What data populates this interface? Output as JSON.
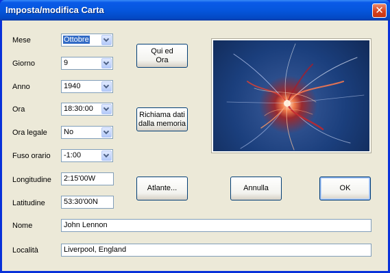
{
  "window": {
    "title": "Imposta/modifica Carta",
    "close_glyph": "✕"
  },
  "fields": {
    "mese": {
      "label": "Mese",
      "value": "Ottobre"
    },
    "giorno": {
      "label": "Giorno",
      "value": "9"
    },
    "anno": {
      "label": "Anno",
      "value": "1940"
    },
    "ora": {
      "label": "Ora",
      "value": "18:30:00"
    },
    "ora_legale": {
      "label": "Ora legale",
      "value": "No"
    },
    "fuso": {
      "label": "Fuso orario",
      "value": "-1:00"
    },
    "longitudine": {
      "label": "Longitudine",
      "value": "2:15'00W"
    },
    "latitudine": {
      "label": "Latitudine",
      "value": "53:30'00N"
    },
    "nome": {
      "label": "Nome",
      "value": "John Lennon"
    },
    "localita": {
      "label": "Località",
      "value": "Liverpool, England"
    }
  },
  "buttons": {
    "qui_ed_ora": [
      "Qui ed",
      "Ora"
    ],
    "richiama": [
      "Richiama dati",
      "dalla memoria"
    ],
    "atlante": "Atlante...",
    "annulla": "Annulla",
    "ok": "OK"
  },
  "image": {
    "icon": "fractal-image"
  },
  "colors": {
    "titlebar": "#0556dd",
    "dialog_bg": "#ece9d8",
    "selection": "#316ac5",
    "close_button": "#d6421e"
  }
}
